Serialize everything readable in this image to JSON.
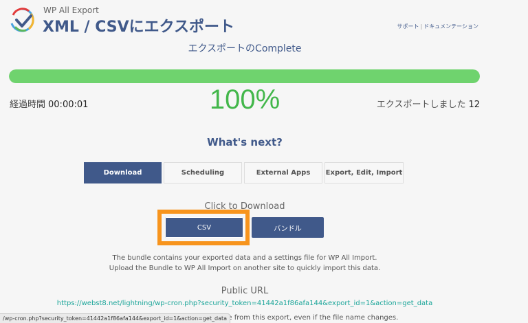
{
  "header": {
    "brand": "WP All Export",
    "title": "XML / CSVにエクスポート",
    "links": {
      "support": "サポート",
      "separator": "|",
      "docs": "ドキュメンテーション"
    }
  },
  "status": {
    "title": "エクスポートのComplete",
    "progress": 100,
    "percent_label": "100%",
    "elapsed_label": "経過時間",
    "elapsed_value": "00:00:01",
    "exported_label": "エクスポートしました",
    "exported_count": "12"
  },
  "next": {
    "title": "What's next?",
    "tabs": [
      {
        "label": "Download",
        "active": true
      },
      {
        "label": "Scheduling",
        "active": false
      },
      {
        "label": "External Apps",
        "active": false
      },
      {
        "label": "Export, Edit, Import",
        "active": false
      }
    ]
  },
  "download": {
    "label": "Click to Download",
    "csv_button": "CSV",
    "bundle_button": "バンドル",
    "desc_line1": "The bundle contains your exported data and a settings file for WP All Import.",
    "desc_line2": "Upload the Bundle to WP All Import on another site to quickly import this data."
  },
  "public_url": {
    "title": "Public URL",
    "url": "https://webst8.net/lightning/wp-cron.php?security_token=41442a1f86afa144&export_id=1&action=get_data",
    "note": "ort file from this export, even if the file name changes."
  },
  "browser_status": {
    "text": "/wp-cron.php?security_token=41442a1f86afa144&export_id=1&action=get_data"
  },
  "colors": {
    "accent": "#40598a",
    "progress": "#6fd36e",
    "percent": "#43b74b",
    "highlight": "#f7941d",
    "link": "#1ba599"
  }
}
